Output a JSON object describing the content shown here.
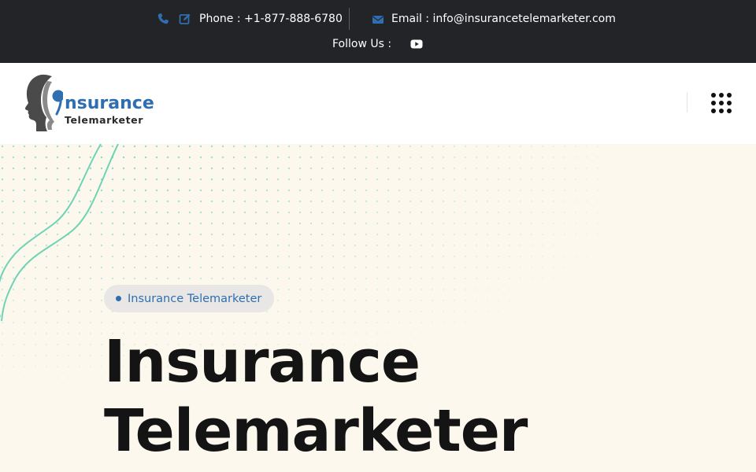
{
  "topbar": {
    "phone_text": "Phone : +1-877-888-6780",
    "email_text": "Email : info@insurancetelemarketer.com",
    "follow_label": "Follow Us :",
    "icons": [
      "phone-icon",
      "edit-icon",
      "envelope-icon",
      "youtube-icon"
    ]
  },
  "header": {
    "logo_word": "nsurance",
    "logo_sub": "Telemarketer",
    "menu_icon": "grid-dots-icon"
  },
  "hero": {
    "badge": "Insurance Telemarketer",
    "title_line1": "Insurance",
    "title_line2": "Telemarketer"
  },
  "colors": {
    "topbar_bg": "#232427",
    "accent": "#2f6eb0",
    "hero_bg": "#fdf8ee",
    "wave": "#6fd3b4",
    "title": "#141414"
  }
}
